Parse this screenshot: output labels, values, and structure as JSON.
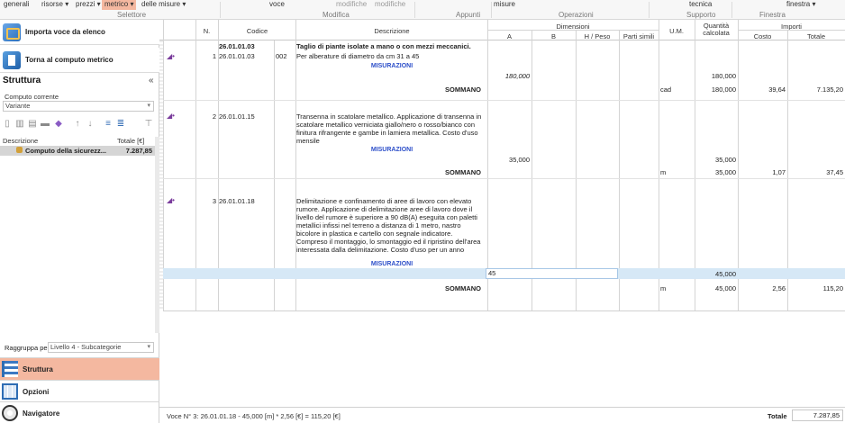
{
  "ribbon": {
    "buttons": [
      {
        "label": "generali",
        "arrow": false
      },
      {
        "label": "risorse",
        "arrow": true
      },
      {
        "label": "prezzi",
        "arrow": true
      },
      {
        "label": "metrico",
        "arrow": true,
        "active": true
      },
      {
        "label": "delle misure",
        "arrow": true
      },
      {
        "label": "voce",
        "arrow": false
      },
      {
        "label": "modifiche",
        "arrow": false,
        "dim": true
      },
      {
        "label": "modifiche",
        "arrow": false,
        "dim": true
      },
      {
        "label": "misure",
        "arrow": false
      },
      {
        "label": "tecnica",
        "arrow": false
      },
      {
        "label": "finestra",
        "arrow": true
      }
    ],
    "groups": [
      "Selettore",
      "Modifica",
      "Appunti",
      "Operazioni",
      "Supporto",
      "Finestra"
    ],
    "dropdown_mark": "▾"
  },
  "left": {
    "import_btn": "Importa voce da elenco",
    "back_btn": "Torna al computo metrico",
    "panel_title": "Struttura",
    "collapse": "«",
    "computo_label": "Computo corrente",
    "computo_value": "Variante",
    "tree_col_desc": "Descrizione",
    "tree_col_total": "Totale [€]",
    "tree_item_label": "Computo della sicurezz...",
    "tree_item_total": "7.287,85",
    "group_label": "Raggruppa per",
    "group_value": "Livello 4 - Subcategorie",
    "nav": [
      {
        "label": "Struttura",
        "active": true
      },
      {
        "label": "Opzioni",
        "active": false
      },
      {
        "label": "Navigatore",
        "active": false
      }
    ]
  },
  "grid": {
    "headers": {
      "n": "N.",
      "codice": "Codice",
      "descrizione": "Descrizione",
      "dimensioni": "Dimensioni",
      "a": "A",
      "b": "B",
      "h": "H / Peso",
      "parti": "Parti simili",
      "um": "U.M.",
      "quantita": "Quantità calcolata",
      "importi": "Importi",
      "costo": "Costo",
      "totale": "Totale"
    },
    "misurazioni_label": "MISURAZIONI",
    "sommano_label": "SOMMANO",
    "items": [
      {
        "n": "1",
        "codice_top": "26.01.01.03",
        "codice": "26.01.01.03",
        "sub": "002",
        "title": "Taglio di piante isolate a mano o con mezzi meccanici.",
        "desc": "Per alberature di diametro da cm 31 a 45",
        "misura_a": "180,000",
        "misura_qty": "180,000",
        "um": "cad",
        "qty": "180,000",
        "costo": "39,64",
        "totale": "7.135,20"
      },
      {
        "n": "2",
        "codice": "26.01.01.15",
        "desc": "Transenna in scatolare metallico. Applicazione di transenna in scatolare metallico verniciata giallo/nero o rosso/bianco con finitura rifrangente e gambe in lamiera metallica. Costo d'uso mensile",
        "misura_a": "35,000",
        "misura_qty": "35,000",
        "um": "m",
        "qty": "35,000",
        "costo": "1,07",
        "totale": "37,45"
      },
      {
        "n": "3",
        "codice": "26.01.01.18",
        "desc": "Delimitazione e confinamento di aree di lavoro con elevato rumore. Applicazione di delimitazione aree di lavoro dove il livello del rumore è superiore a 90 dB(A) eseguita con paletti metallici infissi nel terreno a distanza di 1 metro, nastro bicolore in plastica e cartello con segnale indicatore. Compreso il montaggio, lo smontaggio ed il ripristino dell'area interessata dalla delimitazione. Costo d'uso per un anno",
        "misura_a": "45",
        "misura_qty": "45,000",
        "um": "m",
        "qty": "45,000",
        "costo": "2,56",
        "totale": "115,20"
      }
    ]
  },
  "status": {
    "text": "Voce N° 3: 26.01.01.18 - 45,000 [m] * 2,56 [€] = 115,20 [€]",
    "total_label": "Totale",
    "total_value": "7.287,85"
  }
}
